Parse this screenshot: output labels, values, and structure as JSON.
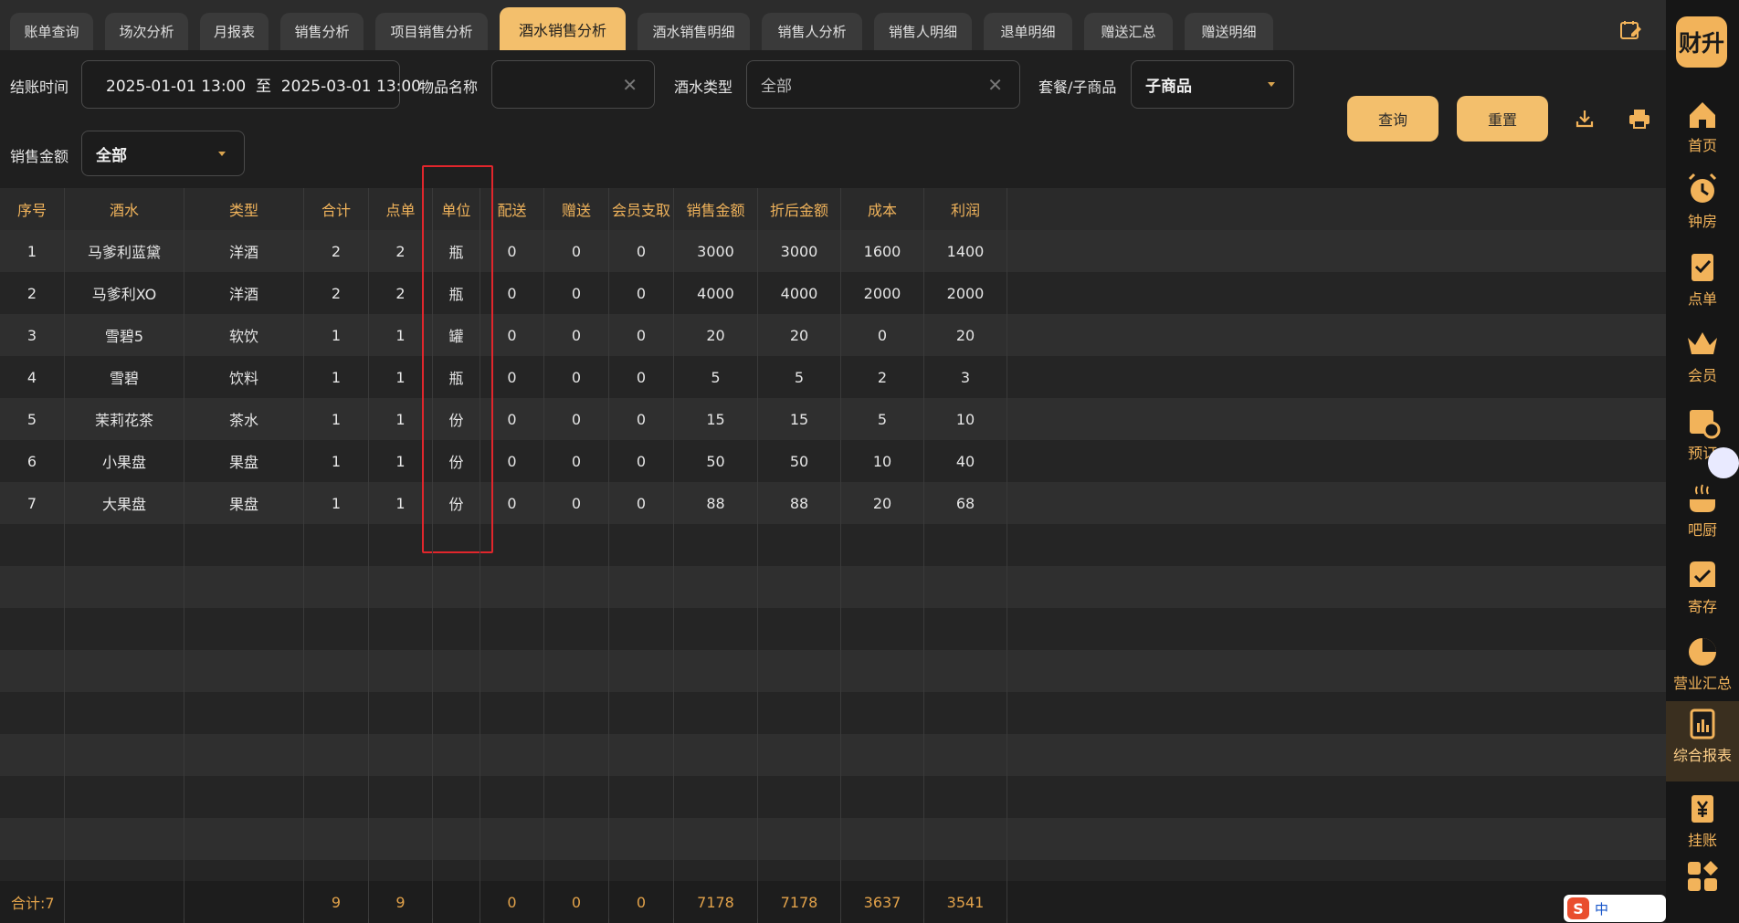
{
  "tabs": [
    "账单查询",
    "场次分析",
    "月报表",
    "销售分析",
    "项目销售分析",
    "酒水销售分析",
    "酒水销售明细",
    "销售人分析",
    "销售人明细",
    "退单明细",
    "赠送汇总",
    "赠送明细"
  ],
  "active_tab": "酒水销售分析",
  "filters": {
    "checkout_time_label": "结账时间",
    "checkout_time_value": "2025-01-01 13:00  至  2025-03-01 13:00",
    "item_name_label": "物品名称",
    "item_name_value": "",
    "drink_type_label": "酒水类型",
    "drink_type_value": "全部",
    "combo_label": "套餐/子商品",
    "combo_value": "子商品",
    "sales_amount_label": "销售金额",
    "sales_amount_value": "全部"
  },
  "buttons": {
    "query": "查询",
    "reset": "重置"
  },
  "table": {
    "headers": [
      "序号",
      "酒水",
      "类型",
      "合计",
      "点单",
      "单位",
      "配送",
      "赠送",
      "会员支取",
      "销售金额",
      "折后金额",
      "成本",
      "利润"
    ],
    "rows": [
      [
        "1",
        "马爹利蓝黛",
        "洋酒",
        "2",
        "2",
        "瓶",
        "0",
        "0",
        "0",
        "3000",
        "3000",
        "1600",
        "1400"
      ],
      [
        "2",
        "马爹利XO",
        "洋酒",
        "2",
        "2",
        "瓶",
        "0",
        "0",
        "0",
        "4000",
        "4000",
        "2000",
        "2000"
      ],
      [
        "3",
        "雪碧5",
        "软饮",
        "1",
        "1",
        "罐",
        "0",
        "0",
        "0",
        "20",
        "20",
        "0",
        "20"
      ],
      [
        "4",
        "雪碧",
        "饮料",
        "1",
        "1",
        "瓶",
        "0",
        "0",
        "0",
        "5",
        "5",
        "2",
        "3"
      ],
      [
        "5",
        "茉莉花茶",
        "茶水",
        "1",
        "1",
        "份",
        "0",
        "0",
        "0",
        "15",
        "15",
        "5",
        "10"
      ],
      [
        "6",
        "小果盘",
        "果盘",
        "1",
        "1",
        "份",
        "0",
        "0",
        "0",
        "50",
        "50",
        "10",
        "40"
      ],
      [
        "7",
        "大果盘",
        "果盘",
        "1",
        "1",
        "份",
        "0",
        "0",
        "0",
        "88",
        "88",
        "20",
        "68"
      ]
    ],
    "totals": [
      "合计:7",
      "",
      "",
      "9",
      "9",
      "",
      "0",
      "0",
      "0",
      "7178",
      "7178",
      "3637",
      "3541"
    ]
  },
  "sidebar": {
    "logo": "财升",
    "items": [
      "首页",
      "钟房",
      "点单",
      "会员",
      "预订",
      "吧厨",
      "寄存",
      "营业汇总",
      "综合报表",
      "挂账",
      "更多"
    ],
    "active": "综合报表"
  },
  "ime": {
    "lang": "中"
  }
}
